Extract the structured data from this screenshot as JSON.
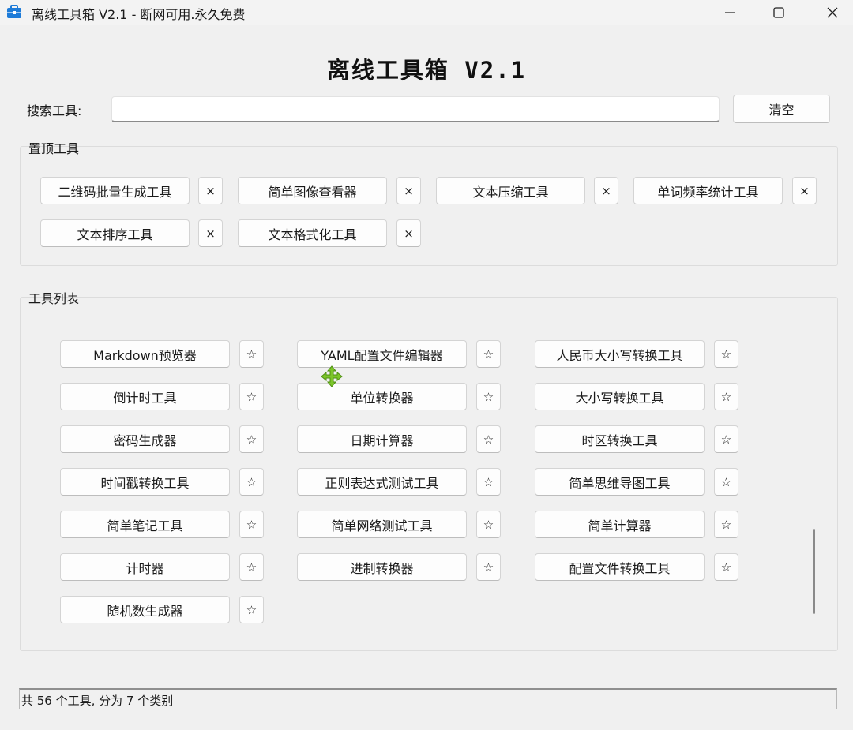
{
  "window": {
    "title": "离线工具箱 V2.1 - 断网可用.永久免费",
    "icons": {
      "app": "toolbox-icon",
      "minimize": "minimize-icon",
      "maximize": "maximize-icon",
      "close": "close-icon"
    }
  },
  "header": {
    "title": "离线工具箱 V2.1"
  },
  "search": {
    "label": "搜索工具:",
    "value": "",
    "placeholder": "",
    "clear_label": "清空"
  },
  "pinned": {
    "title": "置顶工具",
    "remove_symbol": "×",
    "items": [
      {
        "label": "二维码批量生成工具"
      },
      {
        "label": "简单图像查看器"
      },
      {
        "label": "文本压缩工具"
      },
      {
        "label": "单词频率统计工具"
      },
      {
        "label": "文本排序工具"
      },
      {
        "label": "文本格式化工具"
      }
    ]
  },
  "tool_list": {
    "title": "工具列表",
    "pin_symbol": "☆",
    "items": [
      {
        "label": "Markdown预览器"
      },
      {
        "label": "YAML配置文件编辑器"
      },
      {
        "label": "人民币大小写转换工具"
      },
      {
        "label": "倒计时工具"
      },
      {
        "label": "单位转换器"
      },
      {
        "label": "大小写转换工具"
      },
      {
        "label": "密码生成器"
      },
      {
        "label": "日期计算器"
      },
      {
        "label": "时区转换工具"
      },
      {
        "label": "时间戳转换工具"
      },
      {
        "label": "正则表达式测试工具"
      },
      {
        "label": "简单思维导图工具"
      },
      {
        "label": "简单笔记工具"
      },
      {
        "label": "简单网络测试工具"
      },
      {
        "label": "简单计算器"
      },
      {
        "label": "计时器"
      },
      {
        "label": "进制转换器"
      },
      {
        "label": "配置文件转换工具"
      },
      {
        "label": "随机数生成器"
      }
    ]
  },
  "status": {
    "text": "共 56 个工具, 分为 7 个类别"
  },
  "colors": {
    "window_bg": "#f0f0f0",
    "button_bg": "#fdfdfd",
    "icon_blue": "#1e7bd8",
    "cursor_green": "#7cc62a"
  }
}
